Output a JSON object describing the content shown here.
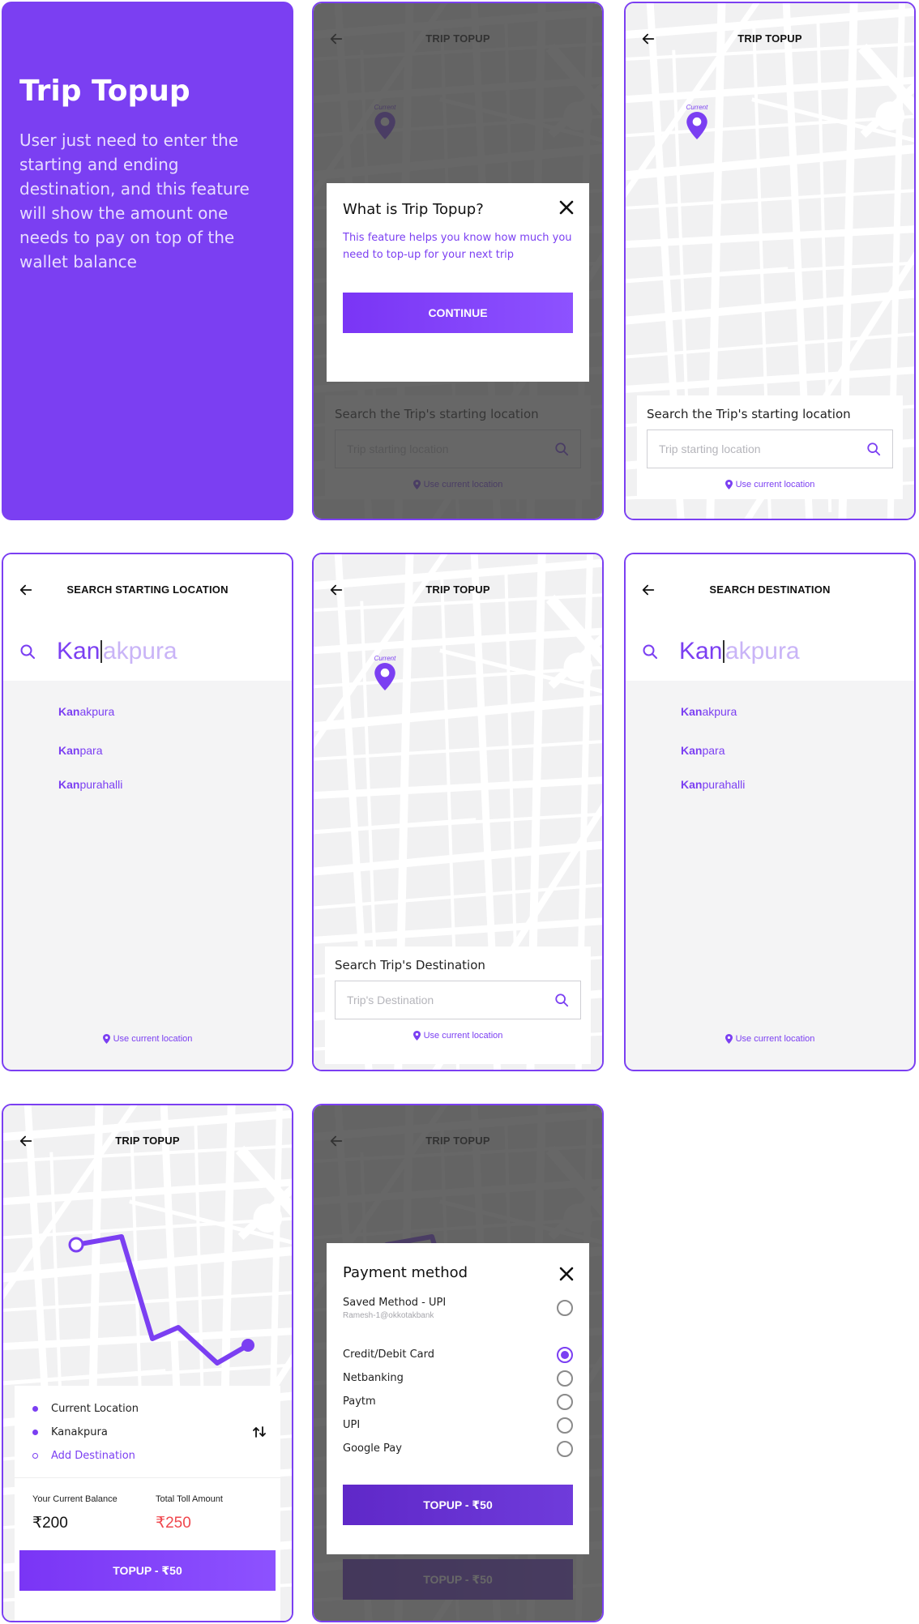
{
  "intro": {
    "title": "Trip Topup",
    "body": "User just need to enter the starting and ending destination, and this feature will show the amount one needs to pay on top of the wallet balance"
  },
  "screens": {
    "trip_topup_title": "TRIP TOPUP",
    "search_start_title": "SEARCH STARTING LOCATION",
    "search_dest_title": "SEARCH DESTINATION",
    "pin_label": "Current"
  },
  "info_modal": {
    "title": "What is Trip Topup?",
    "description": "This feature helps you know how much you need to top-up for your next trip",
    "continue_label": "CONTINUE"
  },
  "start_search": {
    "heading": "Search the Trip's starting location",
    "placeholder": "Trip starting location",
    "use_current": "Use current location"
  },
  "dest_search": {
    "heading": "Search Trip's Destination",
    "placeholder": "Trip's Destination",
    "use_current": "Use current location"
  },
  "autocomplete": {
    "typed": "Kan",
    "ghost": "akpura",
    "suggestions": [
      {
        "match": "Kan",
        "rest": "akpura"
      },
      {
        "match": "Kan",
        "rest": "para"
      },
      {
        "match": "Kan",
        "rest": "purahalli"
      }
    ],
    "use_current": "Use current location"
  },
  "route": {
    "stops": [
      "Current Location",
      "Kanakpura"
    ],
    "add_destination": "Add Destination",
    "balance_label": "Your Current Balance",
    "balance_value": "₹200",
    "toll_label": "Total Toll Amount",
    "toll_value": "₹250",
    "topup_label": "TOPUP - ₹50"
  },
  "payment": {
    "title": "Payment method",
    "saved_method": "Saved Method - UPI",
    "saved_id": "Ramesh-1@okkotakbank",
    "options": [
      "Credit/Debit Card",
      "Netbanking",
      "Paytm",
      "UPI",
      "Google Pay"
    ],
    "selected": "Credit/Debit Card",
    "topup_label": "TOPUP - ₹50"
  },
  "colors": {
    "accent": "#7b3ff2",
    "toll_red": "#f0474d",
    "ghost_text": "#c9b4f7"
  }
}
